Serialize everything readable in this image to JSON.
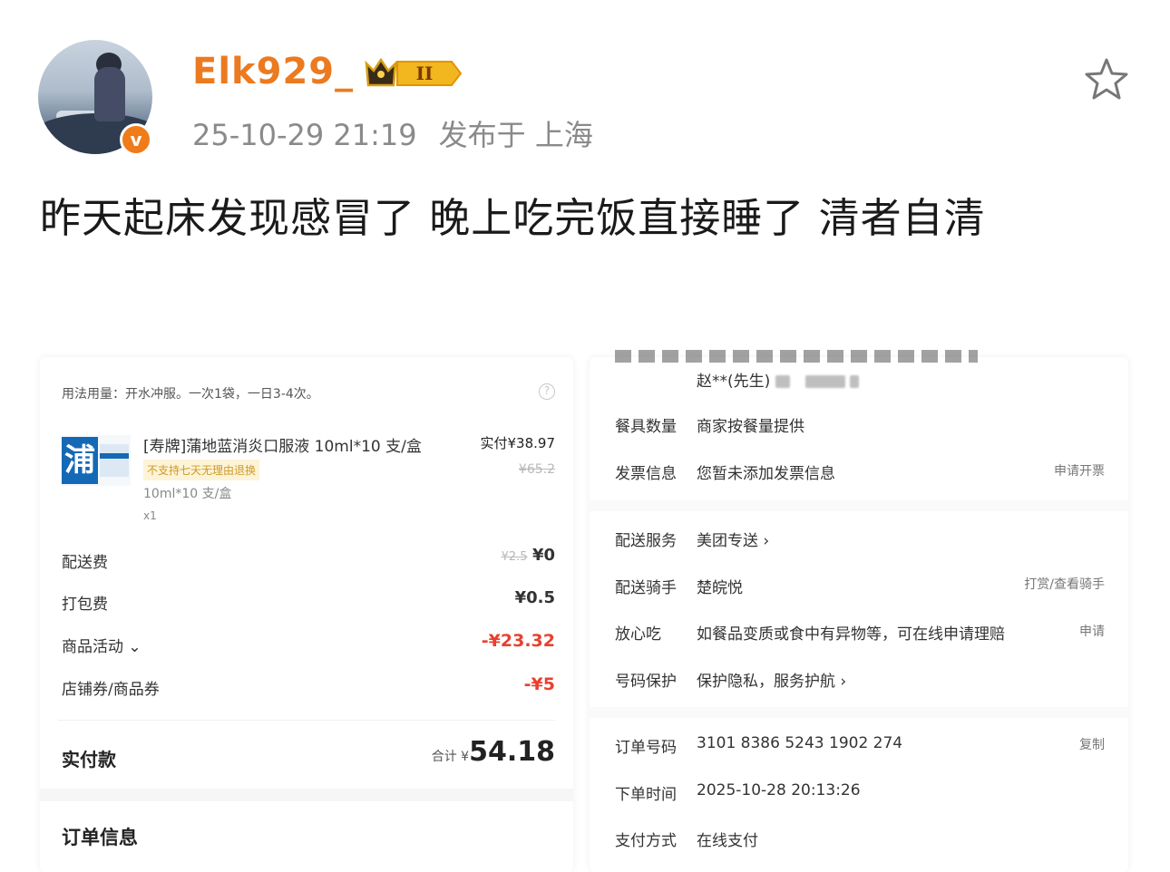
{
  "post": {
    "username": "Elk929_",
    "verified_badge": "v",
    "level_badge": "II",
    "timestamp": "25-10-29 21:19",
    "location": "发布于 上海",
    "text": "昨天起床发现感冒了 晚上吃完饭直接睡了  清者自清"
  },
  "order_left": {
    "usage_note": "用法用量：开水冲服。一次1袋，一日3-4次。",
    "product": {
      "name": "[寿牌]蒲地蓝消炎口服液 10ml*10 支/盒",
      "image_char": "浦",
      "tag": "不支持七天无理由退换",
      "spec": "10ml*10 支/盒",
      "qty": "x1",
      "paid_label": "实付¥38.97",
      "original_price": "¥65.2"
    },
    "fees": [
      {
        "label": "配送费",
        "original": "¥2.5",
        "value": "¥0"
      },
      {
        "label": "打包费",
        "value": "¥0.5"
      },
      {
        "label": "商品活动 ⌄",
        "value": "-¥23.32"
      },
      {
        "label": "店铺券/商品券",
        "value": "-¥5"
      }
    ],
    "total_label": "实付款",
    "total_prefix": "合计 ¥",
    "total_value": "54.18",
    "order_info_title": "订单信息"
  },
  "order_right": {
    "recipient": "赵**(先生)",
    "rows": [
      {
        "label": "餐具数量",
        "value": "商家按餐量提供",
        "action": ""
      },
      {
        "label": "发票信息",
        "value": "您暂未添加发票信息",
        "action": "申请开票"
      },
      {
        "label": "配送服务",
        "value": "美团专送 ›",
        "action": ""
      },
      {
        "label": "配送骑手",
        "value": "楚皖悦",
        "action": "打赏/查看骑手"
      },
      {
        "label": "放心吃",
        "value": "如餐品变质或食中有异物等，可在线申请理赔",
        "action": "申请"
      },
      {
        "label": "号码保护",
        "value": "保护隐私，服务护航 ›",
        "action": ""
      },
      {
        "label": "订单号码",
        "value": "3101 8386 5243 1902 274",
        "action": "复制"
      },
      {
        "label": "下单时间",
        "value": "2025-10-28 20:13:26",
        "action": ""
      },
      {
        "label": "支付方式",
        "value": "在线支付",
        "action": ""
      }
    ]
  },
  "icons": {
    "star": "star-outline-icon",
    "help": "question-circle-icon",
    "crown": "crown-icon"
  },
  "colors": {
    "username": "#eb7a20",
    "verified": "#f07b19",
    "discount_red": "#e8402e",
    "meta_gray": "#8a8a8a"
  }
}
